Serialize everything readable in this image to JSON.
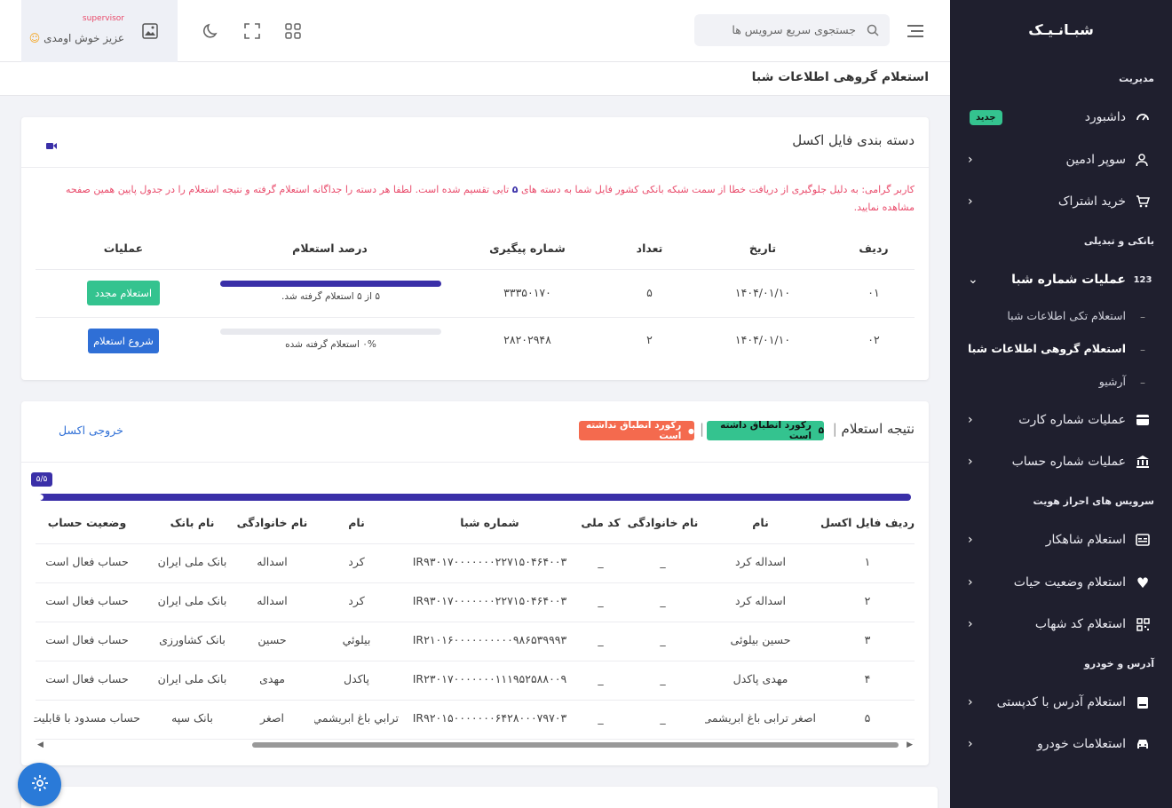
{
  "sidebar": {
    "brand": "شبـانـیـک",
    "sections": {
      "management": "مدیریت",
      "banking": "بانکی و تبدیلی",
      "identity": "سرویس های احراز هویت",
      "address": "آدرس و خودرو"
    },
    "items": [
      {
        "label": "داشبورد",
        "icon": "dashboard-icon",
        "badge": "جدید"
      },
      {
        "label": "سوپر ادمین",
        "icon": "user-admin-icon"
      },
      {
        "label": "خرید اشتراک",
        "icon": "cart-icon"
      },
      {
        "label": "عملیات شماره شبا",
        "icon": "123"
      },
      {
        "label": "عملیات شماره کارت",
        "icon": "card-icon"
      },
      {
        "label": "عملیات شماره حساب",
        "icon": "bank-icon"
      },
      {
        "label": "استعلام شاهکار",
        "icon": "id-card-icon"
      },
      {
        "label": "استعلام وضعیت حیات",
        "icon": "heart-icon"
      },
      {
        "label": "استعلام کد شهاب",
        "icon": "qr-icon"
      },
      {
        "label": "استعلام آدرس با کدپستی",
        "icon": "mailbox-icon"
      },
      {
        "label": "استعلامات خودرو",
        "icon": "car-icon"
      }
    ],
    "sub_items": [
      "استعلام تکی اطلاعات شبا",
      "استعلام گروهی اطلاعات شبا",
      "آرشیو"
    ]
  },
  "topbar": {
    "search_placeholder": "جستجوی سریع سرویس ها",
    "welcome": "عزیز خوش اومدی",
    "user_name": "supervisor"
  },
  "page": {
    "title": "استعلام گروهی اطلاعات شبا"
  },
  "batch": {
    "title": "دسته بندی فایل اکسل",
    "notice_pre": "کاربر گرامی: به دلیل جلوگیری از دریافت خطا از سمت شبکه بانکی کشور فایل شما به دسته های",
    "notice_num": "۵",
    "notice_post": "تایی تقسیم شده است. لطفا هر دسته را جداگانه استعلام گرفته و نتیجه استعلام را در جدول پایین همین صفحه مشاهده نمایید.",
    "headers": [
      "ردیف",
      "تاریخ",
      "تعداد",
      "شماره پیگیری",
      "درصد استعلام",
      "عملیات"
    ],
    "rows": [
      {
        "row": "۰۱",
        "date": "۱۴۰۴/۰۱/۱۰",
        "count": "۵",
        "tracking": "۳۳۳۵۰۱۷۰",
        "progress": 1.0,
        "progress_text": "۵ از ۵ استعلام گرفته شد.",
        "action": "استعلام مجدد",
        "action_color": "#34c38f"
      },
      {
        "row": "۰۲",
        "date": "۱۴۰۴/۰۱/۱۰",
        "count": "۲",
        "tracking": "۲۸۲۰۲۹۴۸",
        "progress": 0,
        "progress_text": "۰% استعلام گرفته شده",
        "action": "شروع استعلام",
        "action_color": "#2f6fd6"
      }
    ]
  },
  "results": {
    "title": "نتیجه استعلام",
    "matched_count": "۵",
    "matched_label": "رکورد انطباق داشته است",
    "unmatched_dot": "●",
    "unmatched_label": "رکورد انطباق نداشته است",
    "export": "خروجی اکسل",
    "progress_label": "۵/۵",
    "progress": 1.0,
    "headers": [
      "ردیف فایل اکسل",
      "نام",
      "نام خانوادگی",
      "کد ملی",
      "شماره شبا",
      "نام",
      "نام خانوادگی",
      "نام بانک",
      "وضعیت حساب"
    ],
    "rows": [
      [
        "۱",
        "اسداله کرد",
        "_",
        "_",
        "IR۹۳۰۱۷۰۰۰۰۰۰۰۲۲۷۱۵۰۴۶۴۰۰۳",
        "کرد",
        "اسداله",
        "بانک ملی ایران",
        "حساب فعال است"
      ],
      [
        "۲",
        "اسداله کرد",
        "_",
        "_",
        "IR۹۳۰۱۷۰۰۰۰۰۰۰۲۲۷۱۵۰۴۶۴۰۰۳",
        "کرد",
        "اسداله",
        "بانک ملی ایران",
        "حساب فعال است"
      ],
      [
        "۳",
        "حسین بیلوئی",
        "_",
        "_",
        "IR۲۱۰۱۶۰۰۰۰۰۰۰۰۰۰۹۸۶۵۳۹۹۹۳",
        "بیلوئي",
        "حسين",
        "بانک کشاورزی",
        "حساب فعال است"
      ],
      [
        "۴",
        "مهدی پاکدل",
        "_",
        "_",
        "IR۲۳۰۱۷۰۰۰۰۰۰۰۱۱۱۹۵۲۵۸۸۰۰۹",
        "پاکدل",
        "مهدی",
        "بانک ملی ایران",
        "حساب فعال است"
      ],
      [
        "۵",
        "اصغر ترابی باغ ابریشمی",
        "_",
        "_",
        "IR۹۲۰۱۵۰۰۰۰۰۰۰۶۴۲۸۰۰۰۷۹۷۰۳",
        "ترابي باغ ابريشمي",
        "اصغر",
        "بانک سپه",
        "حساب مسدود با قابليت"
      ]
    ]
  },
  "colors": {
    "sidebar": "#1f1f2e",
    "accent": "#3a2fa8",
    "success": "#34c38f",
    "danger": "#f46a4e",
    "primary": "#2f6fd6"
  }
}
